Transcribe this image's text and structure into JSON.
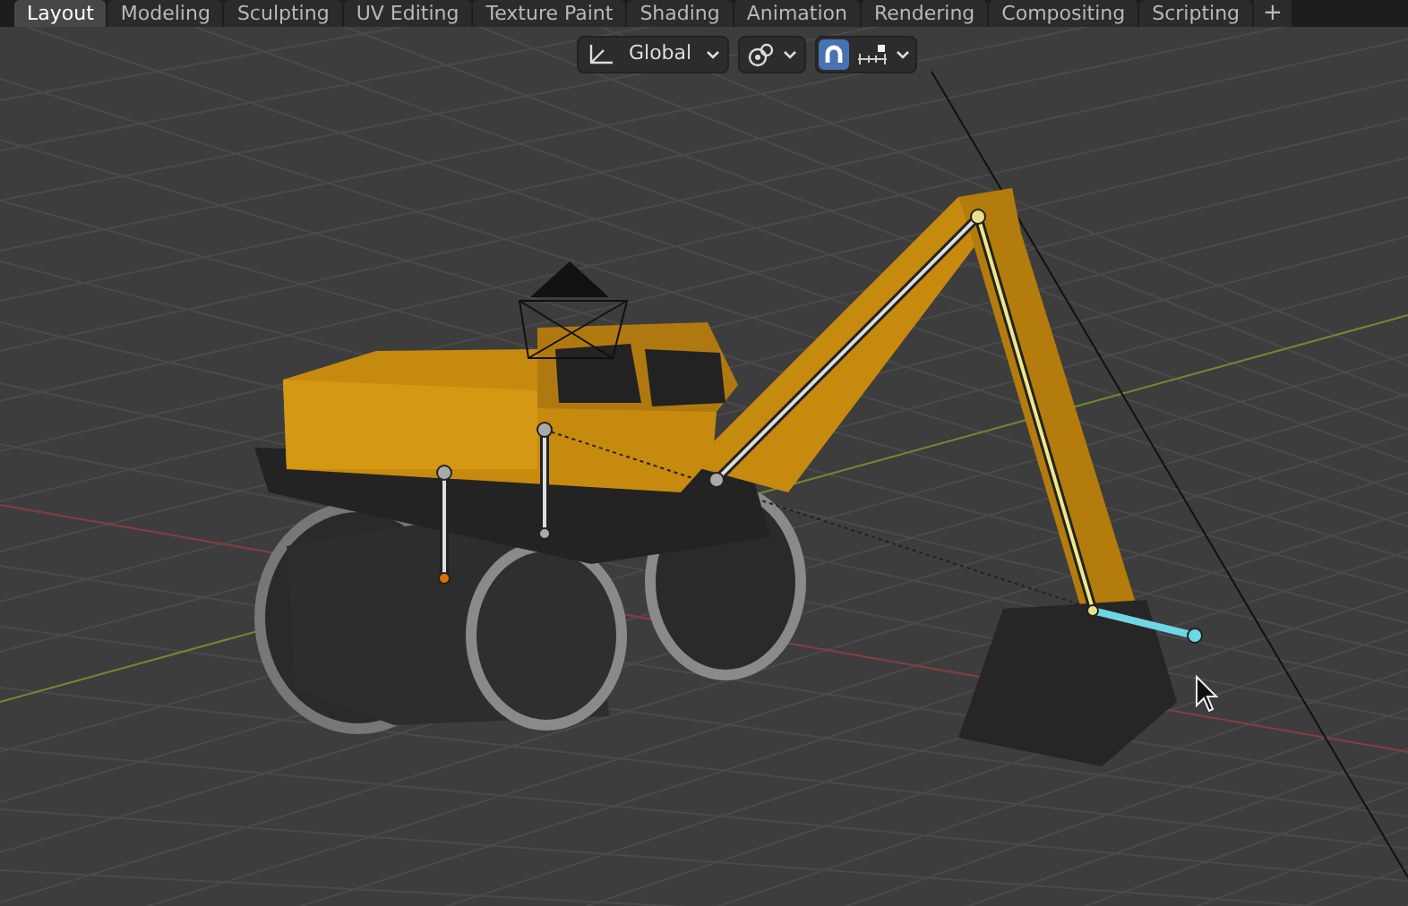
{
  "workspace_tabs": [
    {
      "label": "Layout",
      "selected": true
    },
    {
      "label": "Modeling",
      "selected": false
    },
    {
      "label": "Sculpting",
      "selected": false
    },
    {
      "label": "UV Editing",
      "selected": false
    },
    {
      "label": "Texture Paint",
      "selected": false
    },
    {
      "label": "Shading",
      "selected": false
    },
    {
      "label": "Animation",
      "selected": false
    },
    {
      "label": "Rendering",
      "selected": false
    },
    {
      "label": "Compositing",
      "selected": false
    },
    {
      "label": "Scripting",
      "selected": false
    }
  ],
  "add_tab": "+",
  "header": {
    "orientation": "Global",
    "snap": {
      "on": true
    }
  }
}
